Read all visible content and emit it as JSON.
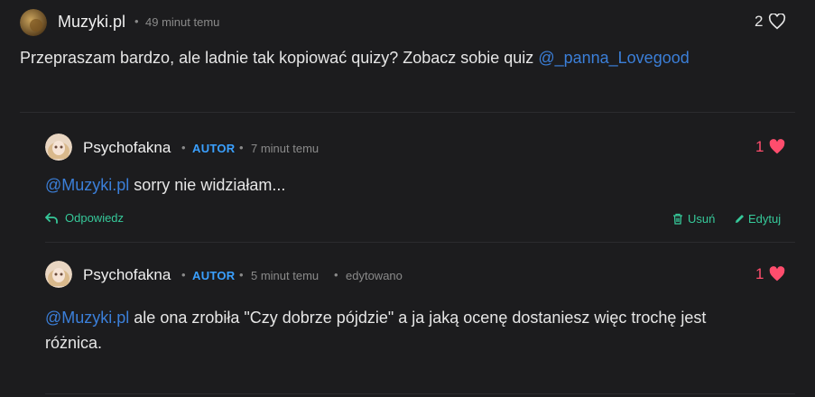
{
  "top_comment": {
    "username": "Muzyki.pl",
    "time": "49 minut temu",
    "likes": "2",
    "text_before": "Przepraszam bardzo, ale ladnie tak kopiować quizy? Zobacz sobie quiz ",
    "mention": "@_panna_Lovegood"
  },
  "replies": [
    {
      "username": "Psychofakna",
      "badge": "AUTOR",
      "time": "7 minut temu",
      "likes": "1",
      "mention": "@Muzyki.pl",
      "text": " sorry nie widziałam...",
      "reply_label": "Odpowiedz",
      "delete_label": "Usuń",
      "edit_label": "Edytuj"
    },
    {
      "username": "Psychofakna",
      "badge": "AUTOR",
      "time": "5 minut temu",
      "edited": "edytowano",
      "likes": "1",
      "mention": "@Muzyki.pl",
      "text_line1": " ale ona zrobiła \"Czy dobrze pójdzie\" a ja jaką ocenę dostaniesz więc trochę jest",
      "text_line2": "różnica."
    }
  ],
  "colors": {
    "background": "#1c1c1e",
    "mention": "#3b7fd9",
    "author_badge": "#3aa0ff",
    "heart": "#ff4d6d",
    "action": "#36c99a"
  },
  "icons": [
    "heart-outline-icon",
    "heart-filled-icon",
    "reply-arrow-icon",
    "trash-icon",
    "pencil-icon"
  ]
}
